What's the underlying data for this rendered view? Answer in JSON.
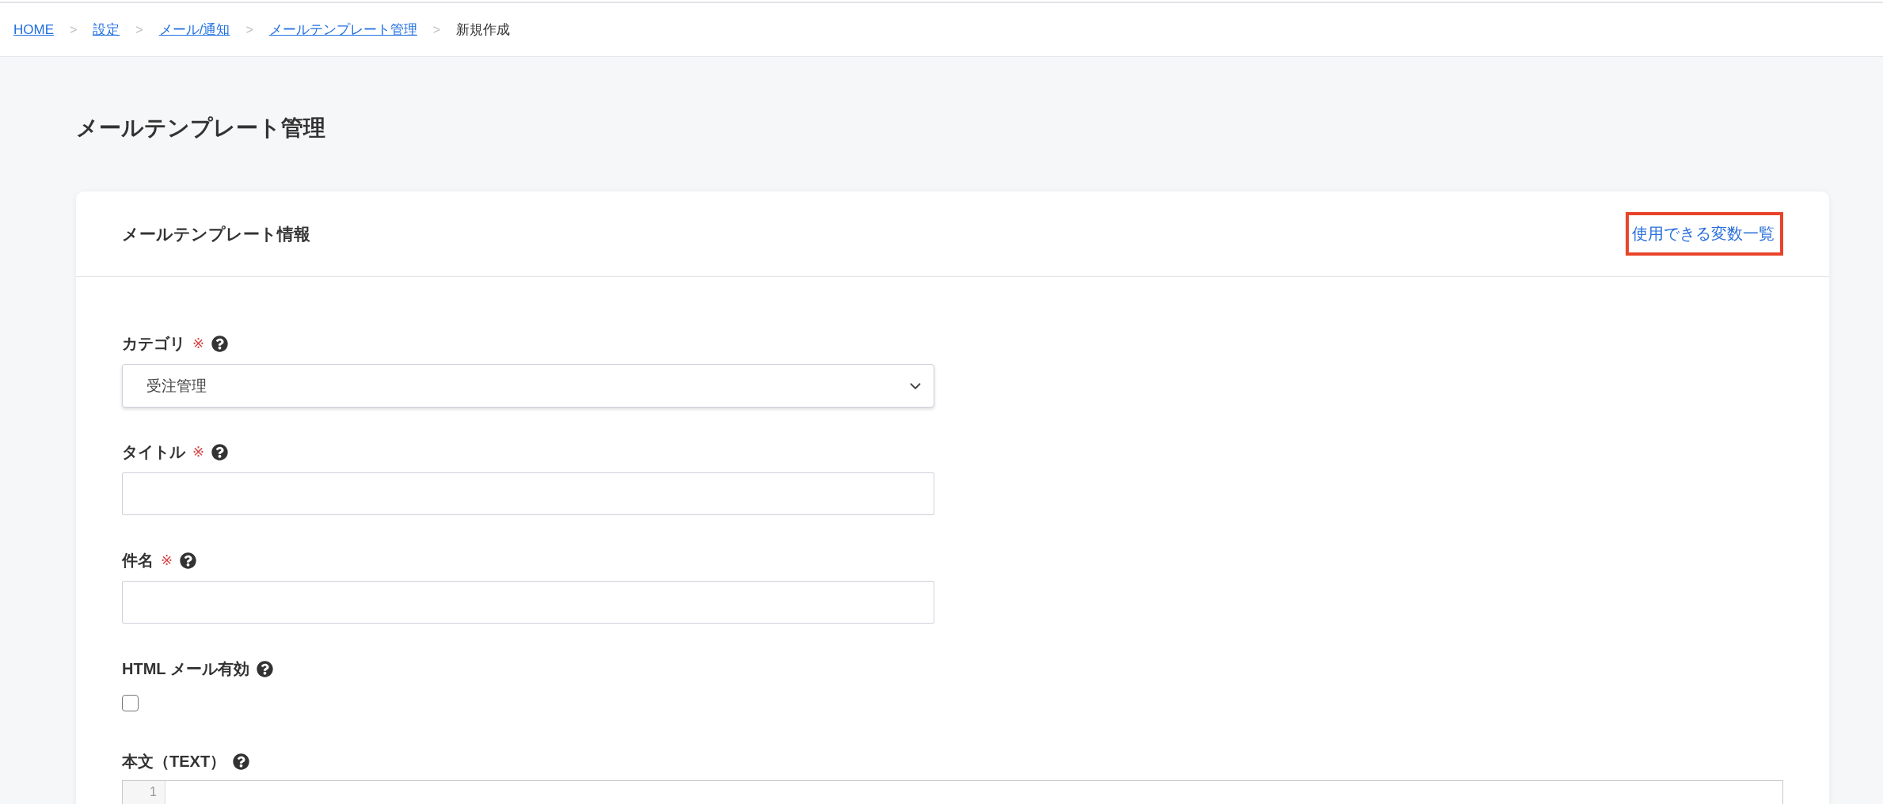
{
  "breadcrumb": {
    "separator": ">",
    "items": [
      {
        "label": "HOME",
        "link": true
      },
      {
        "label": "設定",
        "link": true
      },
      {
        "label": "メール/通知",
        "link": true
      },
      {
        "label": "メールテンプレート管理",
        "link": true
      },
      {
        "label": "新規作成",
        "link": false
      }
    ]
  },
  "page_title": "メールテンプレート管理",
  "card": {
    "title": "メールテンプレート情報",
    "variables_link": {
      "label": "使用できる変数一覧",
      "highlighted": true
    },
    "fields": [
      {
        "kind": "select",
        "label": "カテゴリ",
        "required_mark": "※",
        "help": true,
        "value": "受注管理"
      },
      {
        "kind": "text",
        "label": "タイトル",
        "required_mark": "※",
        "help": true
      },
      {
        "kind": "text",
        "label": "件名",
        "required_mark": "※",
        "help": true
      },
      {
        "kind": "checkbox",
        "label": "HTML メール有効",
        "help": true,
        "checked": false
      },
      {
        "kind": "editor",
        "label": "本文（TEXT）",
        "help": true,
        "line_numbers": [
          "1"
        ]
      }
    ]
  }
}
